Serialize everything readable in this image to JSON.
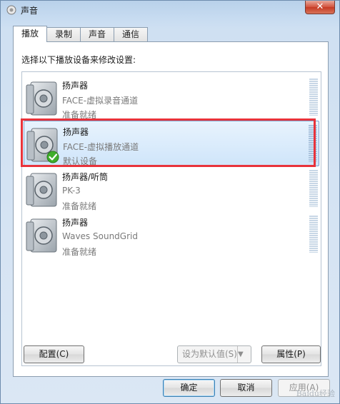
{
  "window": {
    "title": "声音",
    "close_glyph": "✕"
  },
  "tabs": [
    {
      "label": "播放",
      "active": true
    },
    {
      "label": "录制",
      "active": false
    },
    {
      "label": "声音",
      "active": false
    },
    {
      "label": "通信",
      "active": false
    }
  ],
  "instruction": "选择以下播放设备来修改设置:",
  "devices": [
    {
      "name": "扬声器",
      "description": "FACE-虚拟录音通道",
      "status": "准备就绪",
      "icon": "speaker-icon",
      "selected": false
    },
    {
      "name": "扬声器",
      "description": "FACE-虚拟播放通道",
      "status": "默认设备",
      "icon": "speaker-icon",
      "badge": "default-check-icon",
      "selected": true
    },
    {
      "name": "扬声器/听筒",
      "description": "PK-3",
      "status": "准备就绪",
      "icon": "speaker-icon",
      "selected": false
    },
    {
      "name": "扬声器",
      "description": "Waves SoundGrid",
      "status": "准备就绪",
      "icon": "speaker-icon",
      "selected": false
    }
  ],
  "buttons": {
    "configure": "配置(C)",
    "set_default": "设为默认值(S)",
    "properties": "属性(P)",
    "ok": "确定",
    "cancel": "取消",
    "apply": "应用(A)"
  },
  "watermark": "Baidu经验",
  "colors": {
    "highlight": "#e8333b",
    "selection": "#cfe5fa",
    "check": "#3fae2a"
  }
}
